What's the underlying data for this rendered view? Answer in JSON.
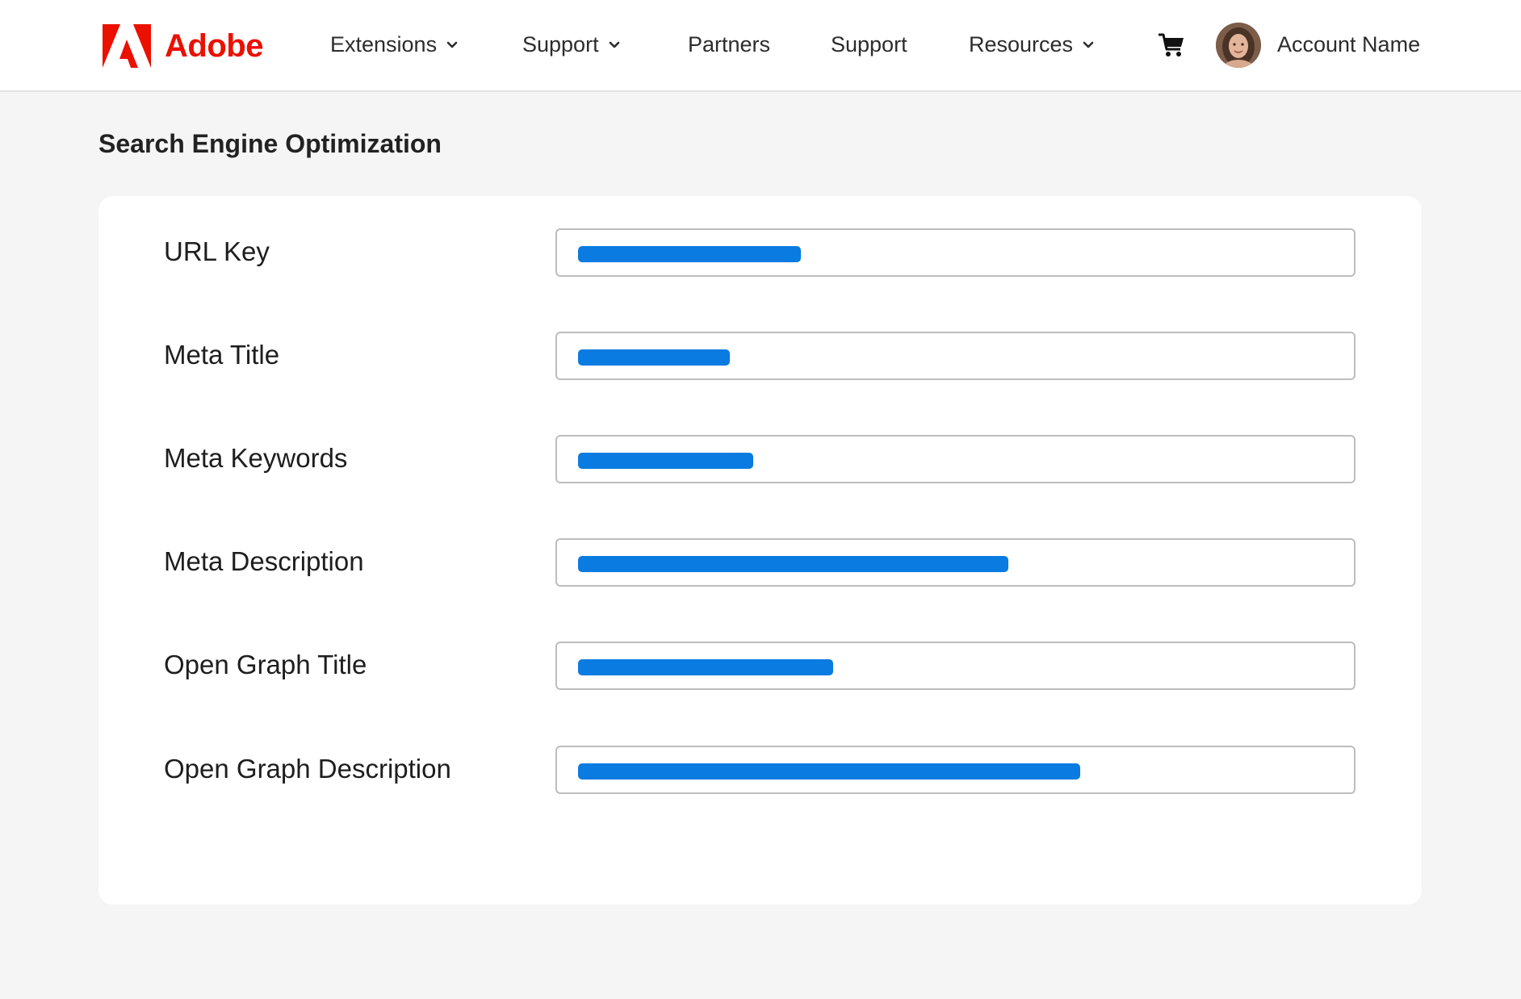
{
  "brand": {
    "name": "Adobe",
    "color": "#eb1000"
  },
  "nav": {
    "extensions": "Extensions",
    "support_dropdown": "Support",
    "partners": "Partners",
    "support": "Support",
    "resources": "Resources"
  },
  "icons": {
    "cart": "shopping-cart-icon",
    "chevron": "chevron-down-icon",
    "avatar": "user-avatar"
  },
  "account": {
    "name": "Account Name"
  },
  "page": {
    "title": "Search Engine Optimization"
  },
  "accent_color": "#0a7be0",
  "fields": [
    {
      "label": "URL Key",
      "value_fill_fraction": 0.28
    },
    {
      "label": "Meta Title",
      "value_fill_fraction": 0.19
    },
    {
      "label": "Meta Keywords",
      "value_fill_fraction": 0.22
    },
    {
      "label": "Meta Description",
      "value_fill_fraction": 0.54
    },
    {
      "label": "Open Graph Title",
      "value_fill_fraction": 0.32
    },
    {
      "label": "Open Graph Description",
      "value_fill_fraction": 0.63
    }
  ]
}
